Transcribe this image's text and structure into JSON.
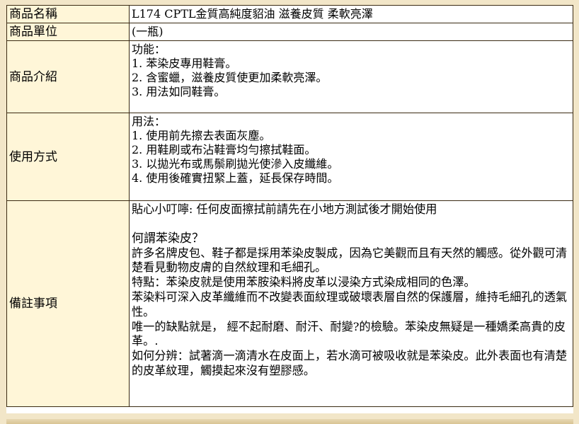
{
  "rows": {
    "name": {
      "label": "商品名稱",
      "value": "L174 CPTL金質高純度貂油 滋養皮質 柔軟亮澤"
    },
    "unit": {
      "label": "商品單位",
      "value": "(一瓶)"
    },
    "intro": {
      "label": "商品介紹",
      "lines": [
        "功能：",
        "1. 苯染皮專用鞋膏。",
        "2. 含蜜蠟，滋養皮質使更加柔軟亮澤。",
        "3. 用法如同鞋膏。"
      ]
    },
    "usage": {
      "label": "使用方式",
      "lines": [
        "用法：",
        "1. 使用前先擦去表面灰塵。",
        "2. 用鞋刷或布沾鞋膏均勻擦拭鞋面。",
        "3. 以拋光布或馬鬃刷拋光使滲入皮纖維。",
        "4. 使用後確實扭緊上蓋，延長保存時間。"
      ]
    },
    "remarks": {
      "label": "備註事項",
      "tip": "貼心小叮嚀: 任何皮面擦拭前請先在小地方測試後才開始使用",
      "question": "何謂苯染皮？",
      "p1": "許多名牌皮包、鞋子都是採用苯染皮製成，因為它美觀而且有天然的觸感。從外觀可清楚看見動物皮膚的自然紋理和毛細孔。",
      "p2": "特點：苯染皮就是使用苯胺染料將皮革以浸染方式染成相同的色澤。",
      "p3": "苯染料可深入皮革纖維而不改變表面紋理或破壞表層自然的保護層，維持毛細孔的透氣性。",
      "p4": "唯一的缺點就是， 經不起耐磨、耐汗、耐變?的檢驗。苯染皮無疑是一種嬌柔高貴的皮革。.",
      "p5": "如何分辨：試著滴一滴清水在皮面上，若水滴可被吸收就是苯染皮。此外表面也有清楚的皮革紋理，觸摸起來沒有塑膠感。"
    }
  }
}
